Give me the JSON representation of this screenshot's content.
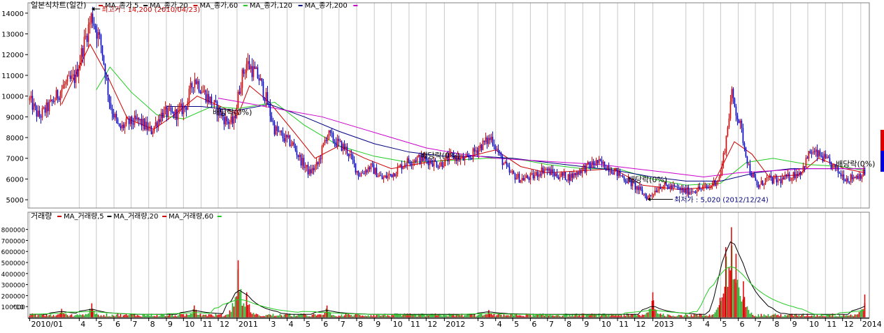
{
  "chart_data": [
    {
      "type": "candlestick",
      "title": "일본식차트(일간)",
      "legend": [
        {
          "name": "MA_종가,5",
          "color": "#cc0000"
        },
        {
          "name": "MA_종가,20",
          "color": "#000000"
        },
        {
          "name": "MA_종가,60",
          "color": "#cc0000"
        },
        {
          "name": "MA_종가,120",
          "color": "#22cc22"
        },
        {
          "name": "MA_종가,200",
          "color": "#000080"
        },
        {
          "name": "",
          "color": "#cc00cc"
        }
      ],
      "ylim": [
        4600,
        14500
      ],
      "yticks": [
        5000,
        6000,
        7000,
        8000,
        9000,
        10000,
        11000,
        12000,
        13000,
        14000
      ],
      "price_path": [
        [
          "2010-01-04",
          9800
        ],
        [
          "2010-01-20",
          9000
        ],
        [
          "2010-02-10",
          9600
        ],
        [
          "2010-03-05",
          10500
        ],
        [
          "2010-03-25",
          10900
        ],
        [
          "2010-04-10",
          12600
        ],
        [
          "2010-04-23",
          13900
        ],
        [
          "2010-05-10",
          12400
        ],
        [
          "2010-05-25",
          9600
        ],
        [
          "2010-06-10",
          8400
        ],
        [
          "2010-06-25",
          8700
        ],
        [
          "2010-07-15",
          8800
        ],
        [
          "2010-08-05",
          8300
        ],
        [
          "2010-08-25",
          9200
        ],
        [
          "2010-09-15",
          9100
        ],
        [
          "2010-10-05",
          9500
        ],
        [
          "2010-10-20",
          10900
        ],
        [
          "2010-11-05",
          10200
        ],
        [
          "2010-11-25",
          9500
        ],
        [
          "2010-12-15",
          8800
        ],
        [
          "2010-12-28",
          8700
        ],
        [
          "2011-01-10",
          10800
        ],
        [
          "2011-01-20",
          11600
        ],
        [
          "2011-02-10",
          10900
        ],
        [
          "2011-02-25",
          9700
        ],
        [
          "2011-03-10",
          8400
        ],
        [
          "2011-03-25",
          8000
        ],
        [
          "2011-04-10",
          7700
        ],
        [
          "2011-04-25",
          6900
        ],
        [
          "2011-05-10",
          6300
        ],
        [
          "2011-05-25",
          6700
        ],
        [
          "2011-06-10",
          8200
        ],
        [
          "2011-06-25",
          7800
        ],
        [
          "2011-07-15",
          7400
        ],
        [
          "2011-08-05",
          6200
        ],
        [
          "2011-08-25",
          6600
        ],
        [
          "2011-09-15",
          6000
        ],
        [
          "2011-10-05",
          6300
        ],
        [
          "2011-10-25",
          6800
        ],
        [
          "2011-11-15",
          7000
        ],
        [
          "2011-12-05",
          6900
        ],
        [
          "2011-12-25",
          6700
        ],
        [
          "2012-01-15",
          7100
        ],
        [
          "2012-02-10",
          6900
        ],
        [
          "2012-03-01",
          7500
        ],
        [
          "2012-03-25",
          8000
        ],
        [
          "2012-04-10",
          7000
        ],
        [
          "2012-04-25",
          6300
        ],
        [
          "2012-05-15",
          6000
        ],
        [
          "2012-06-05",
          6100
        ],
        [
          "2012-06-25",
          6500
        ],
        [
          "2012-07-15",
          6200
        ],
        [
          "2012-08-10",
          6100
        ],
        [
          "2012-09-01",
          6500
        ],
        [
          "2012-09-25",
          6800
        ],
        [
          "2012-10-15",
          6600
        ],
        [
          "2012-11-05",
          6200
        ],
        [
          "2012-11-25",
          5800
        ],
        [
          "2012-12-24",
          5100
        ],
        [
          "2013-01-15",
          5700
        ],
        [
          "2013-02-05",
          5600
        ],
        [
          "2013-03-01",
          5400
        ],
        [
          "2013-03-20",
          5500
        ],
        [
          "2013-04-10",
          5600
        ],
        [
          "2013-04-30",
          6100
        ],
        [
          "2013-05-10",
          7800
        ],
        [
          "2013-05-20",
          10100
        ],
        [
          "2013-06-05",
          8500
        ],
        [
          "2013-06-20",
          6500
        ],
        [
          "2013-07-05",
          5600
        ],
        [
          "2013-07-20",
          6000
        ],
        [
          "2013-08-10",
          5900
        ],
        [
          "2013-08-30",
          6100
        ],
        [
          "2013-09-20",
          6400
        ],
        [
          "2013-10-05",
          7300
        ],
        [
          "2013-10-25",
          7100
        ],
        [
          "2013-11-10",
          6700
        ],
        [
          "2013-11-25",
          6300
        ],
        [
          "2013-12-10",
          6000
        ],
        [
          "2013-12-30",
          6200
        ],
        [
          "2014-01-10",
          6300
        ]
      ],
      "moving_averages": [
        {
          "name": "MA_종가,60",
          "color": "#cc0000",
          "path": [
            [
              "2010-03-01",
              9600
            ],
            [
              "2010-04-20",
              12500
            ],
            [
              "2010-05-20",
              11000
            ],
            [
              "2010-06-25",
              8900
            ],
            [
              "2010-08-10",
              8400
            ],
            [
              "2010-09-15",
              9100
            ],
            [
              "2010-10-25",
              10000
            ],
            [
              "2010-12-05",
              9500
            ],
            [
              "2011-01-05",
              9100
            ],
            [
              "2011-01-25",
              10500
            ],
            [
              "2011-03-01",
              9700
            ],
            [
              "2011-04-15",
              8200
            ],
            [
              "2011-05-20",
              7000
            ],
            [
              "2011-07-01",
              7600
            ],
            [
              "2011-08-15",
              7000
            ],
            [
              "2011-10-01",
              6500
            ],
            [
              "2011-12-01",
              6800
            ],
            [
              "2012-02-01",
              7000
            ],
            [
              "2012-04-01",
              7400
            ],
            [
              "2012-05-15",
              6600
            ],
            [
              "2012-07-01",
              6300
            ],
            [
              "2012-09-01",
              6400
            ],
            [
              "2012-10-25",
              6500
            ],
            [
              "2012-12-15",
              5700
            ],
            [
              "2013-02-15",
              5500
            ],
            [
              "2013-04-15",
              5600
            ],
            [
              "2013-05-25",
              7800
            ],
            [
              "2013-06-25",
              7200
            ],
            [
              "2013-07-25",
              6100
            ],
            [
              "2013-09-15",
              6200
            ],
            [
              "2013-10-20",
              7000
            ],
            [
              "2013-12-05",
              6500
            ],
            [
              "2014-01-10",
              6300
            ]
          ]
        },
        {
          "name": "MA_종가,120",
          "color": "#22cc22",
          "path": [
            [
              "2010-05-01",
              10300
            ],
            [
              "2010-05-25",
              11400
            ],
            [
              "2010-07-01",
              10200
            ],
            [
              "2010-08-15",
              9100
            ],
            [
              "2010-10-01",
              8900
            ],
            [
              "2010-11-20",
              9500
            ],
            [
              "2011-01-05",
              9400
            ],
            [
              "2011-03-10",
              9700
            ],
            [
              "2011-05-01",
              8600
            ],
            [
              "2011-07-01",
              7600
            ],
            [
              "2011-09-01",
              7100
            ],
            [
              "2011-11-01",
              6800
            ],
            [
              "2012-01-15",
              6900
            ],
            [
              "2012-03-15",
              7000
            ],
            [
              "2012-05-01",
              7000
            ],
            [
              "2012-07-01",
              6700
            ],
            [
              "2012-09-01",
              6500
            ],
            [
              "2012-11-01",
              6500
            ],
            [
              "2013-01-01",
              6000
            ],
            [
              "2013-03-01",
              5700
            ],
            [
              "2013-05-01",
              5800
            ],
            [
              "2013-06-15",
              6800
            ],
            [
              "2013-08-01",
              7000
            ],
            [
              "2013-10-01",
              6700
            ],
            [
              "2013-12-01",
              6600
            ],
            [
              "2014-01-10",
              6400
            ]
          ]
        },
        {
          "name": "MA_종가,200",
          "color": "#000080",
          "path": [
            [
              "2010-09-01",
              9500
            ],
            [
              "2010-11-01",
              9500
            ],
            [
              "2011-01-01",
              9300
            ],
            [
              "2011-03-01",
              9600
            ],
            [
              "2011-05-01",
              9000
            ],
            [
              "2011-07-01",
              8300
            ],
            [
              "2011-09-01",
              7700
            ],
            [
              "2011-11-01",
              7300
            ],
            [
              "2012-01-01",
              7100
            ],
            [
              "2012-03-01",
              7100
            ],
            [
              "2012-05-01",
              7000
            ],
            [
              "2012-07-01",
              6800
            ],
            [
              "2012-09-01",
              6600
            ],
            [
              "2012-11-01",
              6400
            ],
            [
              "2013-01-01",
              6100
            ],
            [
              "2013-03-01",
              5900
            ],
            [
              "2013-05-01",
              5900
            ],
            [
              "2013-07-01",
              6300
            ],
            [
              "2013-09-01",
              6500
            ],
            [
              "2013-11-01",
              6500
            ],
            [
              "2014-01-10",
              6500
            ]
          ]
        },
        {
          "name": "",
          "color": "#cc00cc",
          "path": [
            [
              "2010-12-01",
              9900
            ],
            [
              "2011-02-01",
              9600
            ],
            [
              "2011-04-01",
              9300
            ],
            [
              "2011-06-01",
              9000
            ],
            [
              "2011-08-01",
              8500
            ],
            [
              "2011-10-01",
              8000
            ],
            [
              "2011-12-01",
              7500
            ],
            [
              "2012-02-01",
              7200
            ],
            [
              "2012-04-01",
              7000
            ],
            [
              "2012-06-01",
              6900
            ],
            [
              "2012-08-01",
              6800
            ],
            [
              "2012-10-01",
              6700
            ],
            [
              "2012-12-01",
              6500
            ],
            [
              "2013-02-01",
              6300
            ],
            [
              "2013-04-01",
              6100
            ],
            [
              "2013-06-01",
              6300
            ],
            [
              "2013-08-01",
              6400
            ],
            [
              "2013-10-01",
              6500
            ],
            [
              "2014-01-10",
              6500
            ]
          ]
        }
      ],
      "annotations": [
        {
          "text": "최고가 : 14,200 (2010/04/23)",
          "date": "2010-04-23",
          "value": 14200,
          "color": "#cc0000"
        },
        {
          "text": "최저가 : 5,020 (2012/12/24)",
          "date": "2012-12-24",
          "value": 5020,
          "color": "#000080"
        },
        {
          "text": "배당락(0%)",
          "date": "2010-12-28",
          "value": 9100,
          "color": "#000000"
        },
        {
          "text": "배당락(0%)",
          "date": "2011-12-28",
          "value": 7000,
          "color": "#000000"
        },
        {
          "text": "배당락(0%)",
          "date": "2012-12-26",
          "value": 5850,
          "color": "#000000"
        },
        {
          "text": "배당락(0%)",
          "date": "2013-12-26",
          "value": 6600,
          "color": "#000000"
        }
      ]
    },
    {
      "type": "bar",
      "title": "거래량",
      "legend": [
        {
          "name": "MA_거래량,5",
          "color": "#cc0000"
        },
        {
          "name": "MA_거래량,20",
          "color": "#000000"
        },
        {
          "name": "MA_거래량,60",
          "color": "#cc0000"
        },
        {
          "name": "",
          "color": "#22cc22"
        }
      ],
      "unit_label": "*10",
      "ylim": [
        0,
        880000
      ],
      "yticks": [
        100000,
        200000,
        300000,
        400000,
        500000,
        600000,
        700000,
        800000
      ],
      "ytick_labels": [
        "100000",
        "200000",
        "300000",
        "400000",
        "500000",
        "600000",
        "700000",
        "800000"
      ],
      "spikes": [
        {
          "date": "2010-03-01",
          "value": 80000
        },
        {
          "date": "2010-04-23",
          "value": 130000
        },
        {
          "date": "2010-10-20",
          "value": 110000
        },
        {
          "date": "2011-01-05",
          "value": 520000
        },
        {
          "date": "2011-01-20",
          "value": 230000
        },
        {
          "date": "2011-06-10",
          "value": 110000
        },
        {
          "date": "2012-03-20",
          "value": 70000
        },
        {
          "date": "2013-01-02",
          "value": 230000
        },
        {
          "date": "2013-04-30",
          "value": 180000
        },
        {
          "date": "2013-05-10",
          "value": 640000
        },
        {
          "date": "2013-05-20",
          "value": 820000
        },
        {
          "date": "2013-05-28",
          "value": 580000
        },
        {
          "date": "2013-06-10",
          "value": 330000
        },
        {
          "date": "2014-01-09",
          "value": 210000
        }
      ]
    }
  ],
  "x_axis": {
    "start": "2010-01-01",
    "end": "2014-01-17",
    "tick_labels": [
      "2010/01",
      "4",
      "5",
      "6",
      "7",
      "8",
      "9",
      "10",
      "11",
      "12",
      "2011",
      "3",
      "4",
      "5",
      "6",
      "7",
      "8",
      "9",
      "10",
      "11",
      "12",
      "2012",
      "3",
      "4",
      "5",
      "6",
      "7",
      "8",
      "9",
      "10",
      "11",
      "12",
      "2013",
      "3",
      "4",
      "5",
      "6",
      "7",
      "8",
      "9",
      "10",
      "11",
      "12",
      "2014"
    ],
    "tick_dates": [
      "2010-01-04",
      "2010-04-01",
      "2010-05-01",
      "2010-06-01",
      "2010-07-01",
      "2010-08-01",
      "2010-09-01",
      "2010-10-01",
      "2010-11-01",
      "2010-12-01",
      "2011-01-03",
      "2011-03-01",
      "2011-04-01",
      "2011-05-01",
      "2011-06-01",
      "2011-07-01",
      "2011-08-01",
      "2011-09-01",
      "2011-10-01",
      "2011-11-01",
      "2011-12-01",
      "2012-01-02",
      "2012-03-01",
      "2012-04-01",
      "2012-05-01",
      "2012-06-01",
      "2012-07-01",
      "2012-08-01",
      "2012-09-01",
      "2012-10-01",
      "2012-11-01",
      "2012-12-01",
      "2013-01-02",
      "2013-03-01",
      "2013-04-01",
      "2013-05-01",
      "2013-06-01",
      "2013-07-01",
      "2013-08-01",
      "2013-09-01",
      "2013-10-01",
      "2013-11-01",
      "2013-12-01",
      "2014-01-02"
    ]
  }
}
